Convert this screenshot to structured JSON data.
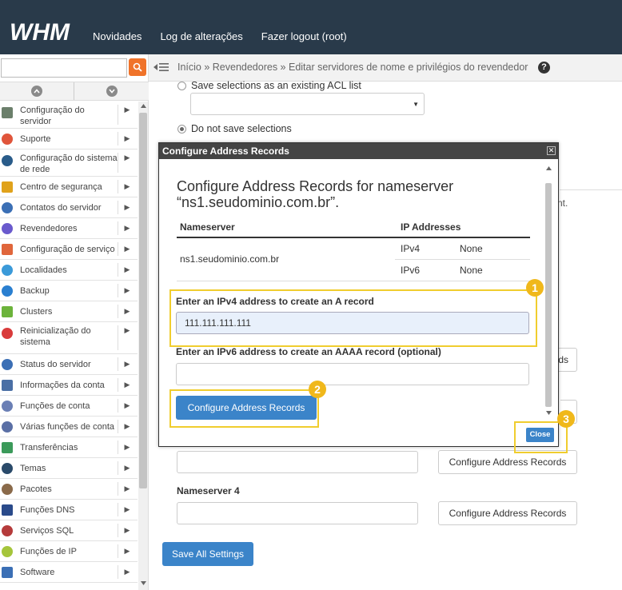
{
  "app": {
    "logo_text": "WHM",
    "nav": [
      "Novidades",
      "Log de alterações",
      "Fazer logout (root)"
    ]
  },
  "breadcrumb": {
    "text": "Início » Revendedores » Editar servidores de nome e privilégios do revendedor",
    "help": "?"
  },
  "sidebar": {
    "search_placeholder": "",
    "items": [
      {
        "label": "Configuração do servidor",
        "icon": "server-config-icon"
      },
      {
        "label": "Suporte",
        "icon": "support-icon"
      },
      {
        "label": "Configuração do sistema de rede",
        "icon": "network-icon"
      },
      {
        "label": "Centro de segurança",
        "icon": "lock-icon"
      },
      {
        "label": "Contatos do servidor",
        "icon": "contacts-icon"
      },
      {
        "label": "Revendedores",
        "icon": "resellers-icon"
      },
      {
        "label": "Configuração de serviço",
        "icon": "service-config-icon"
      },
      {
        "label": "Localidades",
        "icon": "locales-icon"
      },
      {
        "label": "Backup",
        "icon": "backup-icon"
      },
      {
        "label": "Clusters",
        "icon": "clusters-icon"
      },
      {
        "label": "Reinicialização do sistema",
        "icon": "restart-icon"
      },
      {
        "label": "Status do servidor",
        "icon": "server-status-icon"
      },
      {
        "label": "Informações da conta",
        "icon": "account-info-icon"
      },
      {
        "label": "Funções de conta",
        "icon": "account-functions-icon"
      },
      {
        "label": "Várias funções de conta",
        "icon": "multi-account-icon"
      },
      {
        "label": "Transferências",
        "icon": "transfers-icon"
      },
      {
        "label": "Temas",
        "icon": "themes-icon"
      },
      {
        "label": "Pacotes",
        "icon": "packages-icon"
      },
      {
        "label": "Funções DNS",
        "icon": "dns-icon"
      },
      {
        "label": "Serviços SQL",
        "icon": "sql-icon"
      },
      {
        "label": "Funções de IP",
        "icon": "ip-icon"
      },
      {
        "label": "Software",
        "icon": "software-icon"
      }
    ]
  },
  "main": {
    "save_existing_acl": "Save selections as an existing ACL list",
    "do_not_save": "Do not save selections",
    "partial_text": "nt.",
    "partial_button": "ds",
    "nameserver4_label": "Nameserver 4",
    "configure_btn": "Configure Address Records",
    "save_all": "Save All Settings"
  },
  "modal": {
    "header": "Configure Address Records",
    "title": "Configure Address Records for nameserver “ns1.seudominio.com.br”.",
    "col_nameserver": "Nameserver",
    "col_ip": "IP Addresses",
    "nameserver": "ns1.seudominio.com.br",
    "ipv4_label": "IPv4",
    "ipv4_value": "None",
    "ipv6_label": "IPv6",
    "ipv6_value": "None",
    "ipv4_field_label": "Enter an IPv4 address to create an A record",
    "ipv4_field_value": "111.111.111.111",
    "ipv6_field_label": "Enter an IPv6 address to create an AAAA record (optional)",
    "ipv6_field_value": "",
    "submit": "Configure Address Records",
    "close": "Close"
  },
  "callouts": [
    "1",
    "2",
    "3"
  ],
  "colors": {
    "topbar": "#293a4a",
    "accent_blue": "#3b84c9",
    "search_orange": "#f0732a",
    "callout_yellow": "#f0cd2e"
  }
}
